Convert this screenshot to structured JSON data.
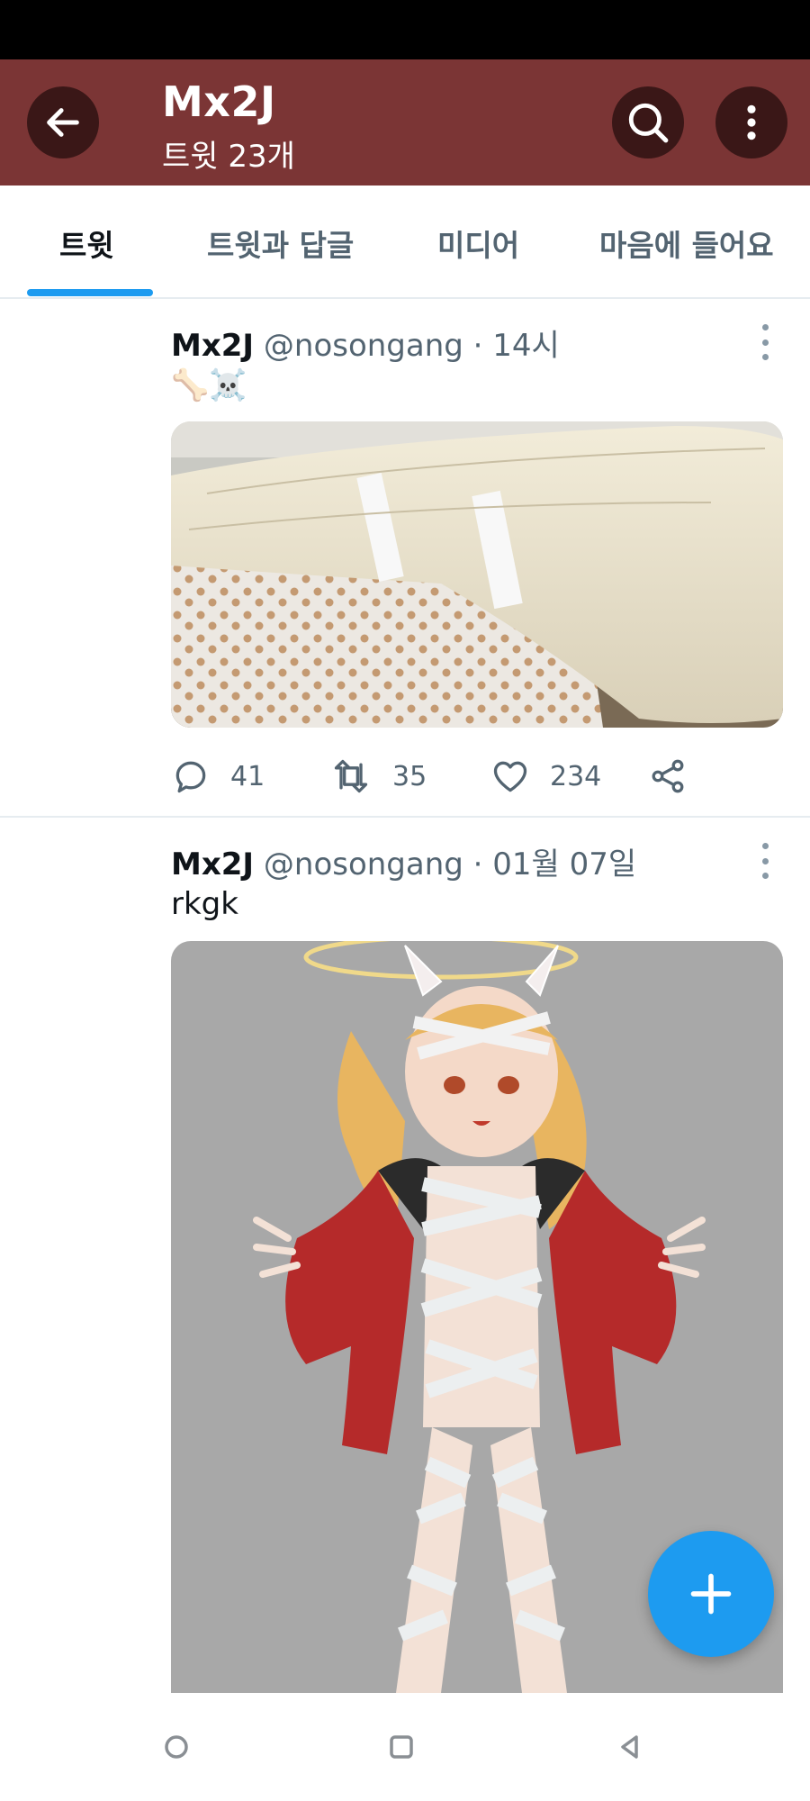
{
  "header": {
    "title": "Mx2J",
    "subtitle": "트윗 23개",
    "icons": {
      "back": "arrow-left-icon",
      "search": "search-icon",
      "more": "more-vertical-icon"
    },
    "color": "#7b3535"
  },
  "tabs": [
    {
      "label": "트윗",
      "active": true
    },
    {
      "label": "트윗과 답글",
      "active": false
    },
    {
      "label": "미디어",
      "active": false
    },
    {
      "label": "마음에 들어요",
      "active": false
    }
  ],
  "tweets": [
    {
      "name": "Mx2J",
      "handle": "@nosongang",
      "dot": "·",
      "time": "14시",
      "text": "🦴☠️",
      "media": "photo of a bandaged arm over a dotted hospital sheet",
      "replies": "41",
      "retweets": "35",
      "likes": "234"
    },
    {
      "name": "Mx2J",
      "handle": "@nosongang",
      "dot": "·",
      "time": "01월 07일",
      "text": "rkgk",
      "media": "illustration of a blonde girl wrapped in bandages wearing a red jacket"
    }
  ],
  "fab": {
    "icon": "plus-icon"
  },
  "accent": "#1d9bf0"
}
